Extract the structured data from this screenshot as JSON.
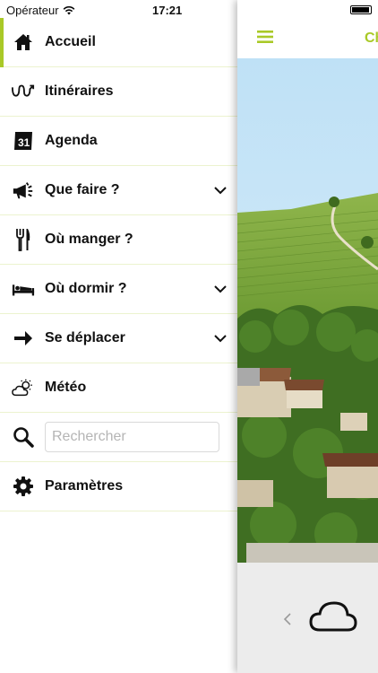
{
  "status_bar": {
    "carrier": "Opérateur",
    "time": "17:21"
  },
  "menu": {
    "items": [
      {
        "label": "Accueil",
        "icon": "home-icon",
        "active": true
      },
      {
        "label": "Itinéraires",
        "icon": "route-icon"
      },
      {
        "label": "Agenda",
        "icon": "calendar-icon",
        "calendar_day": "31"
      },
      {
        "label": "Que faire ?",
        "icon": "megaphone-icon",
        "expandable": true
      },
      {
        "label": "Où manger ?",
        "icon": "fork-knife-icon"
      },
      {
        "label": "Où dormir ?",
        "icon": "bed-icon",
        "expandable": true
      },
      {
        "label": "Se déplacer",
        "icon": "arrow-right-icon",
        "expandable": true
      },
      {
        "label": "Météo",
        "icon": "weather-icon"
      },
      {
        "label": "",
        "icon": "search-icon"
      },
      {
        "label": "Paramètres",
        "icon": "gear-icon"
      }
    ],
    "search_placeholder": "Rechercher"
  },
  "main": {
    "title": "Ch",
    "accent_color": "#a9c927"
  },
  "colors": {
    "accent": "#a9c927",
    "divider": "#ecf3cf"
  }
}
